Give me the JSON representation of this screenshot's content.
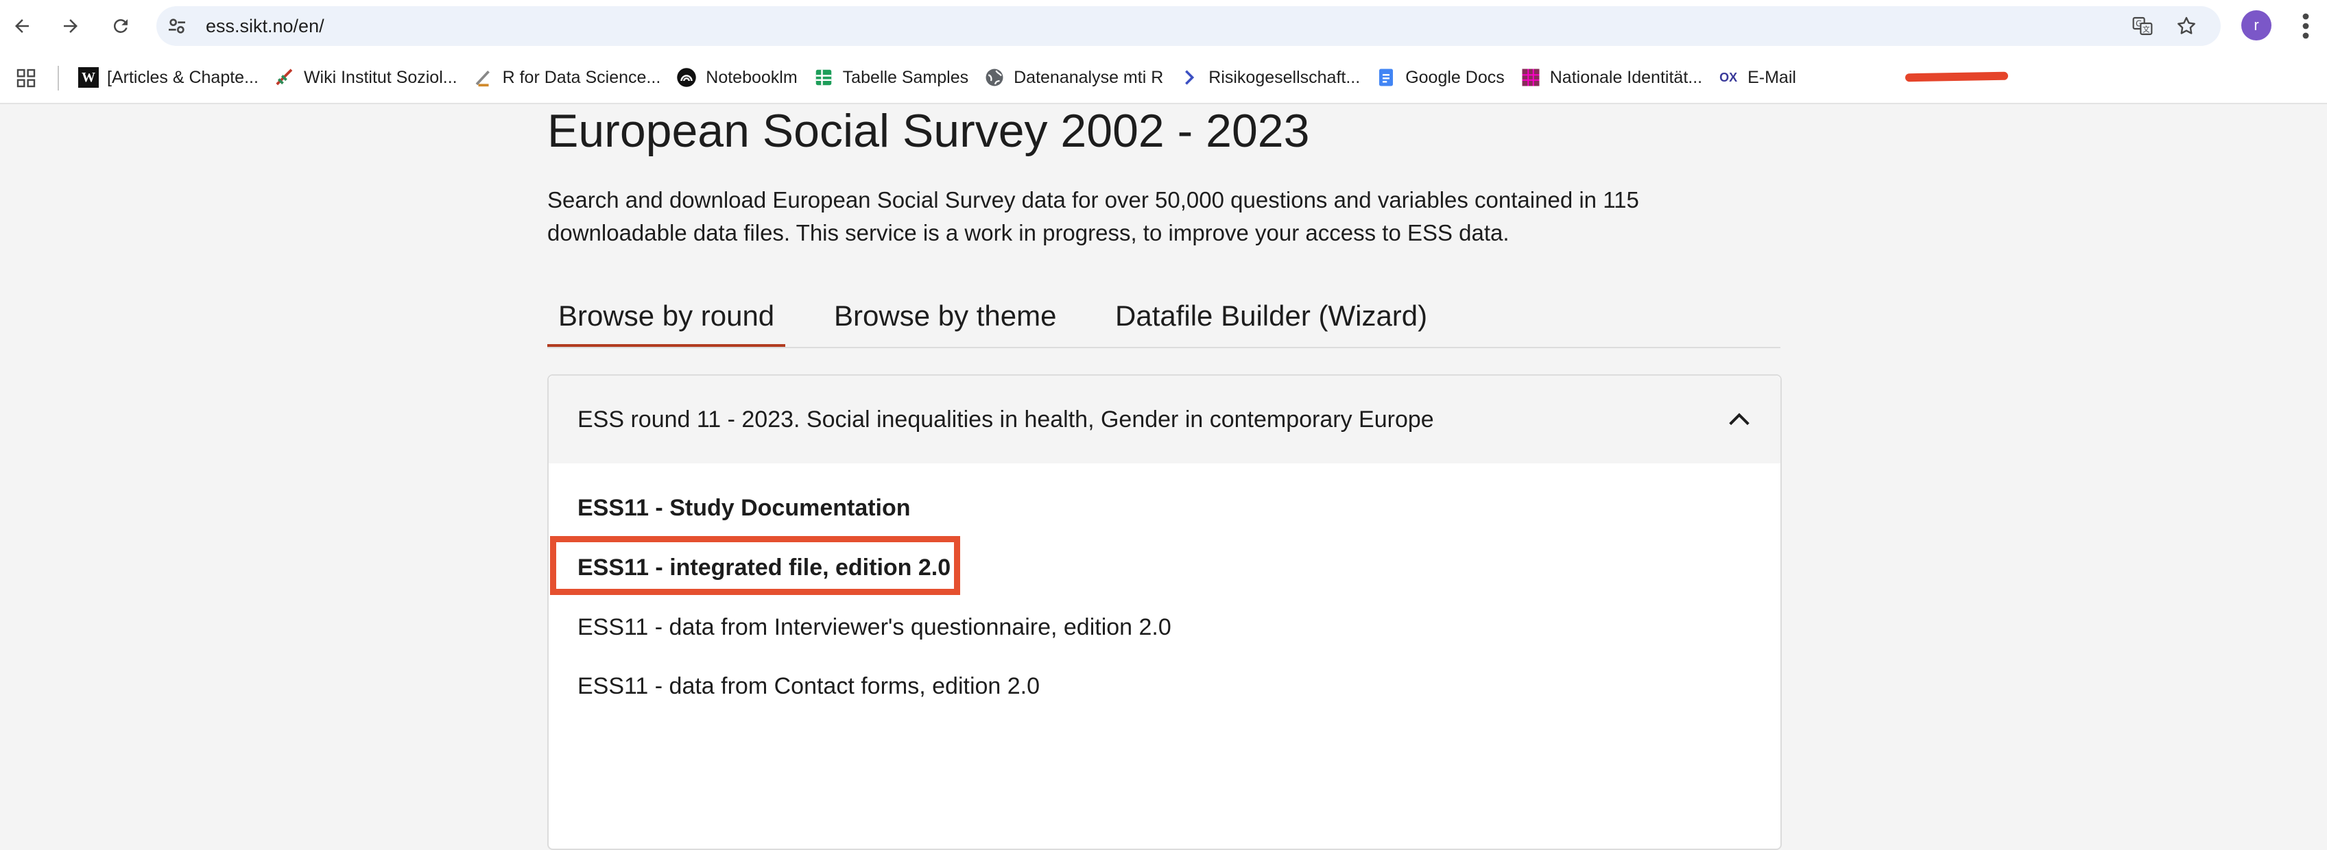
{
  "browser": {
    "url": "ess.sikt.no/en/",
    "profile_initial": "r",
    "accent_color": "#7b57c8",
    "icons": [
      "back-arrow-icon",
      "forward-arrow-icon",
      "reload-icon",
      "site-settings-icon",
      "translate-icon",
      "star-icon",
      "kebab-menu-icon",
      "apps-grid-icon"
    ]
  },
  "bookmarks": [
    {
      "label": "[Articles & Chapte...",
      "icon": "W"
    },
    {
      "label": "Wiki Institut Soziol...",
      "icon": "wiki"
    },
    {
      "label": "R for Data Science...",
      "icon": "r4ds"
    },
    {
      "label": "Notebooklm",
      "icon": "notebooklm"
    },
    {
      "label": "Tabelle Samples",
      "icon": "sheets"
    },
    {
      "label": "Datenanalyse mti R",
      "icon": "globe"
    },
    {
      "label": "Risikogesellschaft...",
      "icon": "chevron"
    },
    {
      "label": "Google Docs",
      "icon": "docs"
    },
    {
      "label": "Nationale Identität...",
      "icon": "grid"
    },
    {
      "label": "E-Mail",
      "icon": "ox"
    }
  ],
  "page": {
    "title": "European Social Survey 2002 - 2023",
    "description": "Search and download European Social Survey data for over 50,000 questions and variables contained in 115 downloadable data files. This service is a work in progress, to improve your access to ESS data.",
    "tabs": [
      {
        "label": "Browse by round",
        "active": true
      },
      {
        "label": "Browse by theme",
        "active": false
      },
      {
        "label": "Datafile Builder (Wizard)",
        "active": false
      }
    ],
    "accent_color": "#b23c20"
  },
  "accordion": {
    "title": "ESS round 11 - 2023. Social inequalities in health, Gender in contemporary Europe",
    "expanded": true,
    "items": [
      {
        "label": "ESS11 - Study Documentation",
        "bold": true
      },
      {
        "label": "ESS11 - integrated file, edition 2.0",
        "bold": true,
        "highlighted": true
      },
      {
        "label": "ESS11 - data from Interviewer's questionnaire, edition 2.0",
        "bold": false
      },
      {
        "label": "ESS11 - data from Contact forms, edition 2.0",
        "bold": false
      }
    ],
    "highlight_color": "#e5502f"
  }
}
